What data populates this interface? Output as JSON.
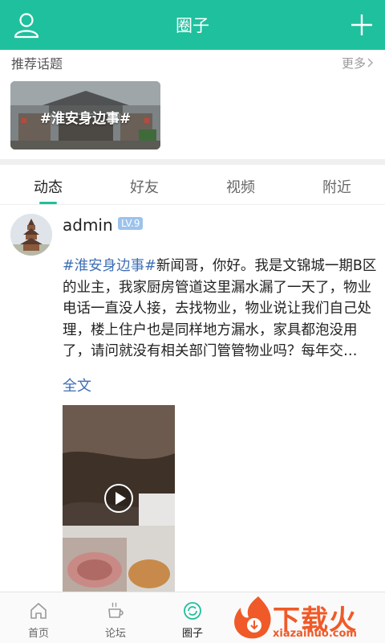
{
  "header": {
    "title": "圈子",
    "left_icon": "user-icon",
    "right_icon": "plus-icon"
  },
  "colors": {
    "brand": "#1fc09d",
    "link": "#3f6fb5",
    "level_badge": "#9cc3ec",
    "watermark": "#f05a28"
  },
  "recommend": {
    "title": "推荐话题",
    "more_label": "更多",
    "topic_card": {
      "label": "#淮安身边事#"
    }
  },
  "tabs": [
    {
      "label": "动态",
      "active": true
    },
    {
      "label": "好友",
      "active": false
    },
    {
      "label": "视频",
      "active": false
    },
    {
      "label": "附近",
      "active": false
    }
  ],
  "post": {
    "username": "admin",
    "level": "LV.9",
    "hashtag": "#淮安身边事#",
    "text": "新闻哥，你好。我是文锦城一期B区的业主，我家厨房管道这里漏水漏了一天了，物业电话一直没人接，去找物业，物业说让我们自己处理，楼上住户也是同样地方漏水，家具都泡没用了，请问就没有相关部门管管物业吗？每年交…",
    "full_text_label": "全文"
  },
  "bottom_nav": [
    {
      "label": "首页",
      "icon": "home-icon",
      "active": false
    },
    {
      "label": "论坛",
      "icon": "coffee-icon",
      "active": false
    },
    {
      "label": "圈子",
      "icon": "circle-icon",
      "active": true
    }
  ],
  "watermark": {
    "text": "下载火",
    "url": "xiazaihuo.com"
  }
}
